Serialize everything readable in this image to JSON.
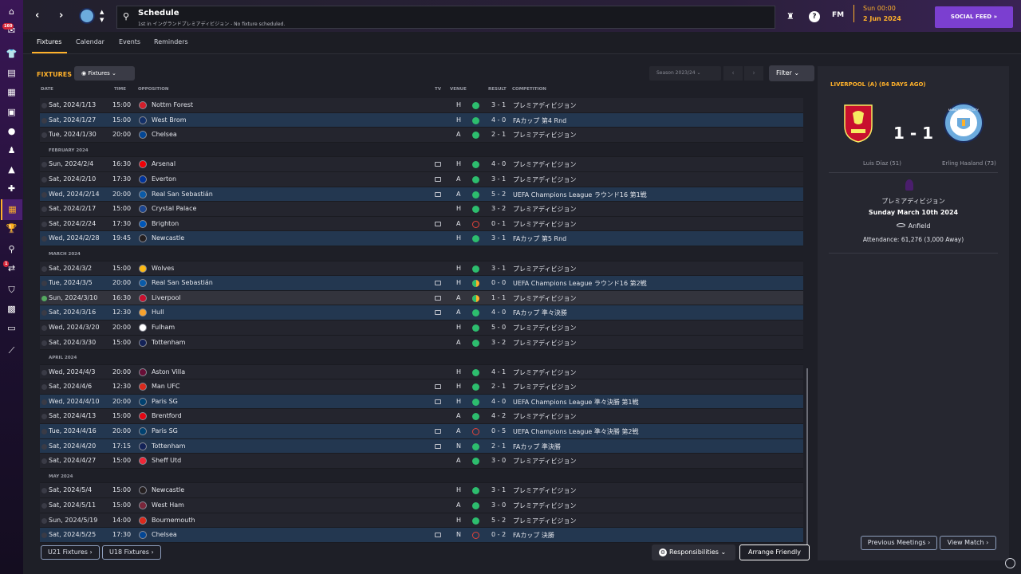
{
  "header": {
    "title": "Schedule",
    "subtitle": "1st in イングランドプレミアディビジョン - No fixture scheduled.",
    "fm_label": "FM",
    "date_day": "Sun 00:00",
    "date_date": "2 Jun 2024",
    "social_feed": "SOCIAL FEED",
    "sidebar_badges": [
      "160",
      "1"
    ]
  },
  "tabs": [
    "Fixtures",
    "Calendar",
    "Events",
    "Reminders"
  ],
  "toolbar": {
    "section_title": "FIXTURES",
    "view_dropdown": "Fixtures",
    "season": "Season 2023/24",
    "filter": "Filter"
  },
  "columns": {
    "date": "DATE",
    "time": "TIME",
    "opposition": "OPPOSITION",
    "tv": "TV",
    "venue": "VENUE",
    "result": "RESULT",
    "competition": "COMPETITION"
  },
  "rows": [
    {
      "date": "Sat, 2024/1/13",
      "time": "15:00",
      "opp": "Nottm Forest",
      "crest": "#d31f2b",
      "tv": false,
      "venue": "H",
      "outcome": "W",
      "score": "3 - 1",
      "comp": "プレミアディビジョン",
      "hl": false
    },
    {
      "date": "Sat, 2024/1/27",
      "time": "15:00",
      "opp": "West Brom",
      "crest": "#122f67",
      "tv": false,
      "venue": "H",
      "outcome": "W",
      "score": "4 - 0",
      "comp": "FAカップ 第4 Rnd",
      "hl": true
    },
    {
      "date": "Tue, 2024/1/30",
      "time": "20:00",
      "opp": "Chelsea",
      "crest": "#034694",
      "tv": false,
      "venue": "A",
      "outcome": "W",
      "score": "2 - 1",
      "comp": "プレミアディビジョン",
      "hl": false
    },
    {
      "month": "FEBRUARY 2024"
    },
    {
      "date": "Sun, 2024/2/4",
      "time": "16:30",
      "opp": "Arsenal",
      "crest": "#ef0107",
      "tv": true,
      "venue": "H",
      "outcome": "W",
      "score": "4 - 0",
      "comp": "プレミアディビジョン",
      "hl": false
    },
    {
      "date": "Sat, 2024/2/10",
      "time": "17:30",
      "opp": "Everton",
      "crest": "#003399",
      "tv": true,
      "venue": "A",
      "outcome": "W",
      "score": "3 - 1",
      "comp": "プレミアディビジョン",
      "hl": false
    },
    {
      "date": "Wed, 2024/2/14",
      "time": "20:00",
      "opp": "Real San Sebastián",
      "crest": "#0a5ba8",
      "tv": true,
      "venue": "A",
      "outcome": "W",
      "score": "5 - 2",
      "comp": "UEFA Champions League ラウンド16 第1戦",
      "hl": true
    },
    {
      "date": "Sat, 2024/2/17",
      "time": "15:00",
      "opp": "Crystal Palace",
      "crest": "#1b458f",
      "tv": false,
      "venue": "H",
      "outcome": "W",
      "score": "3 - 2",
      "comp": "プレミアディビジョン",
      "hl": false
    },
    {
      "date": "Sat, 2024/2/24",
      "time": "17:30",
      "opp": "Brighton",
      "crest": "#0057b8",
      "tv": true,
      "venue": "A",
      "outcome": "L",
      "score": "0 - 1",
      "comp": "プレミアディビジョン",
      "hl": false
    },
    {
      "date": "Wed, 2024/2/28",
      "time": "19:45",
      "opp": "Newcastle",
      "crest": "#241f20",
      "tv": false,
      "venue": "H",
      "outcome": "W",
      "score": "3 - 1",
      "comp": "FAカップ 第5 Rnd",
      "hl": true
    },
    {
      "month": "MARCH 2024"
    },
    {
      "date": "Sat, 2024/3/2",
      "time": "15:00",
      "opp": "Wolves",
      "crest": "#fdb913",
      "tv": false,
      "venue": "H",
      "outcome": "W",
      "score": "3 - 1",
      "comp": "プレミアディビジョン",
      "hl": false
    },
    {
      "date": "Tue, 2024/3/5",
      "time": "20:00",
      "opp": "Real San Sebastián",
      "crest": "#0a5ba8",
      "tv": true,
      "venue": "H",
      "outcome": "D",
      "score": "0 - 0",
      "comp": "UEFA Champions League ラウンド16 第2戦",
      "hl": true
    },
    {
      "date": "Sun, 2024/3/10",
      "time": "16:30",
      "opp": "Liverpool",
      "crest": "#c8102e",
      "tv": true,
      "venue": "A",
      "outcome": "D",
      "score": "1 - 1",
      "comp": "プレミアディビジョン",
      "hl": false,
      "current": true
    },
    {
      "date": "Sat, 2024/3/16",
      "time": "12:30",
      "opp": "Hull",
      "crest": "#f5a12d",
      "tv": true,
      "venue": "A",
      "outcome": "W",
      "score": "4 - 0",
      "comp": "FAカップ 準々決勝",
      "hl": true
    },
    {
      "date": "Wed, 2024/3/20",
      "time": "20:00",
      "opp": "Fulham",
      "crest": "#ffffff",
      "tv": false,
      "venue": "H",
      "outcome": "W",
      "score": "5 - 0",
      "comp": "プレミアディビジョン",
      "hl": false
    },
    {
      "date": "Sat, 2024/3/30",
      "time": "15:00",
      "opp": "Tottenham",
      "crest": "#132257",
      "tv": false,
      "venue": "A",
      "outcome": "W",
      "score": "3 - 2",
      "comp": "プレミアディビジョン",
      "hl": false
    },
    {
      "month": "APRIL 2024"
    },
    {
      "date": "Wed, 2024/4/3",
      "time": "20:00",
      "opp": "Aston Villa",
      "crest": "#670e36",
      "tv": false,
      "venue": "H",
      "outcome": "W",
      "score": "4 - 1",
      "comp": "プレミアディビジョン",
      "hl": false
    },
    {
      "date": "Sat, 2024/4/6",
      "time": "12:30",
      "opp": "Man UFC",
      "crest": "#da291c",
      "tv": true,
      "venue": "H",
      "outcome": "W",
      "score": "2 - 1",
      "comp": "プレミアディビジョン",
      "hl": false
    },
    {
      "date": "Wed, 2024/4/10",
      "time": "20:00",
      "opp": "Paris SG",
      "crest": "#004170",
      "tv": true,
      "venue": "H",
      "outcome": "W",
      "score": "4 - 0",
      "comp": "UEFA Champions League 準々決勝 第1戦",
      "hl": true
    },
    {
      "date": "Sat, 2024/4/13",
      "time": "15:00",
      "opp": "Brentford",
      "crest": "#e30613",
      "tv": false,
      "venue": "A",
      "outcome": "W",
      "score": "4 - 2",
      "comp": "プレミアディビジョン",
      "hl": false
    },
    {
      "date": "Tue, 2024/4/16",
      "time": "20:00",
      "opp": "Paris SG",
      "crest": "#004170",
      "tv": true,
      "venue": "A",
      "outcome": "L",
      "score": "0 - 5",
      "comp": "UEFA Champions League 準々決勝 第2戦",
      "hl": true
    },
    {
      "date": "Sat, 2024/4/20",
      "time": "17:15",
      "opp": "Tottenham",
      "crest": "#132257",
      "tv": true,
      "venue": "N",
      "outcome": "W",
      "score": "2 - 1",
      "comp": "FAカップ 準決勝",
      "hl": true
    },
    {
      "date": "Sat, 2024/4/27",
      "time": "15:00",
      "opp": "Sheff Utd",
      "crest": "#ee2737",
      "tv": false,
      "venue": "A",
      "outcome": "W",
      "score": "3 - 0",
      "comp": "プレミアディビジョン",
      "hl": false
    },
    {
      "month": "MAY 2024"
    },
    {
      "date": "Sat, 2024/5/4",
      "time": "15:00",
      "opp": "Newcastle",
      "crest": "#241f20",
      "tv": false,
      "venue": "H",
      "outcome": "W",
      "score": "3 - 1",
      "comp": "プレミアディビジョン",
      "hl": false
    },
    {
      "date": "Sat, 2024/5/11",
      "time": "15:00",
      "opp": "West Ham",
      "crest": "#7a263a",
      "tv": false,
      "venue": "A",
      "outcome": "W",
      "score": "3 - 0",
      "comp": "プレミアディビジョン",
      "hl": false
    },
    {
      "date": "Sun, 2024/5/19",
      "time": "14:00",
      "opp": "Bournemouth",
      "crest": "#da291c",
      "tv": false,
      "venue": "H",
      "outcome": "W",
      "score": "5 - 2",
      "comp": "プレミアディビジョン",
      "hl": false
    },
    {
      "date": "Sat, 2024/5/25",
      "time": "17:30",
      "opp": "Chelsea",
      "crest": "#034694",
      "tv": true,
      "venue": "N",
      "outcome": "L",
      "score": "0 - 2",
      "comp": "FAカップ 決勝",
      "hl": true
    }
  ],
  "footer": {
    "u21": "U21 Fixtures",
    "u18": "U18 Fixtures",
    "responsibilities": "Responsibilities",
    "arrange": "Arrange Friendly"
  },
  "match_panel": {
    "title": "LIVERPOOL (A) (84 DAYS AGO)",
    "score": "1 - 1",
    "home_scorer": "Luis Díaz (51)",
    "away_scorer": "Erling Haaland (73)",
    "competition": "プレミアディビジョン",
    "date": "Sunday March 10th 2024",
    "stadium": "Anfield",
    "attendance": "Attendance: 61,276 (3,000 Away)",
    "prev_btn": "Previous Meetings",
    "view_btn": "View Match",
    "away_badge_text": "MANCHESTER CITY"
  }
}
